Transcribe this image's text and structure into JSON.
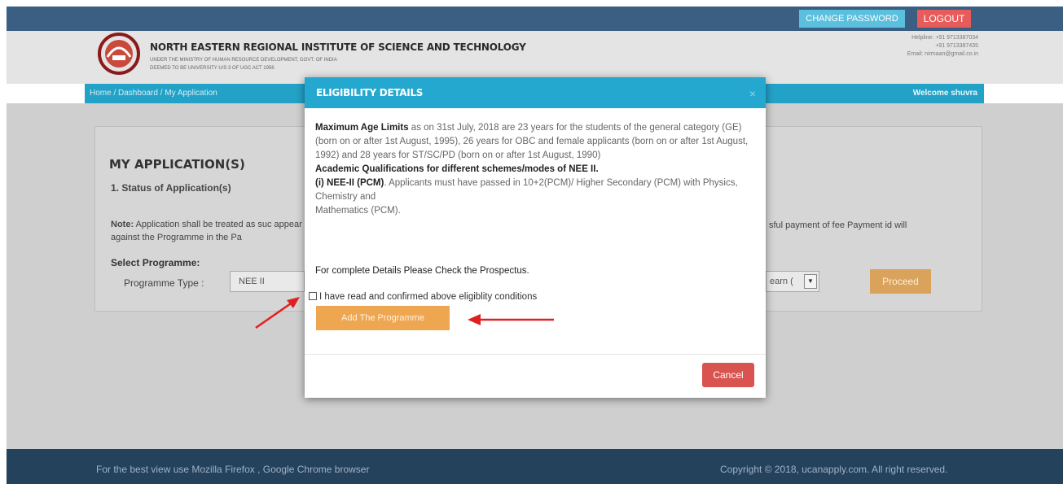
{
  "topbar": {
    "change_password": "CHANGE PASSWORD",
    "logout": "LOGOUT"
  },
  "header": {
    "institute_name": "NORTH EASTERN REGIONAL INSTITUTE OF SCIENCE AND TECHNOLOGY",
    "sub_line1": "UNDER THE MINISTRY OF HUMAN RESOURCE DEVELOPMENT, GOVT. OF INDIA",
    "sub_line2": "DEEMED TO BE UNIVERSITY U/S 3 OF UGC ACT 1956",
    "helpline_label": "Helpline: +91 9713387034",
    "helpline_2": "+91 9713387435",
    "email": "Email: nirmaan@gmail.co.in"
  },
  "nav": {
    "breadcrumb": "Home / Dashboard / My Application",
    "welcome": "Welcome shuvra"
  },
  "main": {
    "title": "MY APPLICATION(S)",
    "status_label": "1. Status of Application(s)",
    "note_label": "Note:",
    "note_text_left": " Application shall be treated as suc appear against the Programme in the Pa",
    "note_text_right": "sful payment of fee Payment id will",
    "select_programme": "Select Programme:",
    "programme_type_label": "Programme Type :",
    "programme_type_value": "NEE II",
    "year_value": "earn (",
    "proceed": "Proceed"
  },
  "modal": {
    "title": "ELIGIBILITY DETAILS",
    "close": "×",
    "max_age_label": "Maximum Age Limits",
    "age_text_1": " as on 31st July, 2018 are 23 years for the students of the general category (GE) (born on or after 1st August, 1995), 26 years for OBC and female applicants (born on or after 1st August, 1992) and 28 years for ST/SC/PD (born on or after 1st August, 1990)",
    "academic_label": "Academic Qualifications for different schemes/modes of NEE II.",
    "nee_label": "(i) NEE-II (PCM)",
    "nee_text": ". Applicants must have passed in 10+2(PCM)/ Higher Secondary (PCM) with Physics, Chemistry and",
    "nee_text_2": "Mathematics (PCM).",
    "prospectus": "For complete Details Please Check the Prospectus.",
    "confirm_text": "I have read and confirmed above eligiblity conditions",
    "add_button": "Add The Programme",
    "cancel_button": "Cancel"
  },
  "footer": {
    "left": "For the best view use Mozilla Firefox , Google Chrome browser",
    "right": "Copyright © 2018, ucanapply.com. All right reserved."
  },
  "colors": {
    "accent": "#25a8cf",
    "topbar": "#3b5f82",
    "footer": "#25425d",
    "danger": "#d9534f",
    "warning": "#eea650",
    "arrow": "#e02020"
  }
}
